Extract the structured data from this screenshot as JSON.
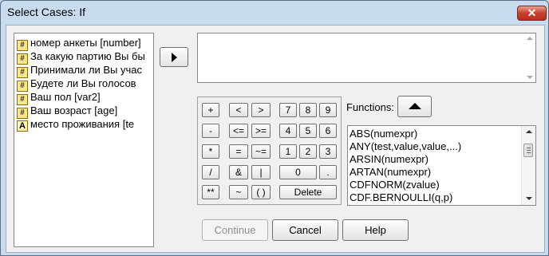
{
  "window": {
    "title": "Select Cases: If",
    "close_glyph": "✕"
  },
  "variables": [
    {
      "label": "номер анкеты [number]",
      "icon": "numeric-var-icon",
      "glyph": "#"
    },
    {
      "label": "За какую партию Вы бы",
      "icon": "numeric-var-icon",
      "glyph": "#"
    },
    {
      "label": "Принимали ли Вы учас",
      "icon": "numeric-var-icon",
      "glyph": "#"
    },
    {
      "label": "Будете ли Вы голосов",
      "icon": "numeric-var-icon",
      "glyph": "#"
    },
    {
      "label": "Ваш пол [var2]",
      "icon": "numeric-var-icon",
      "glyph": "#"
    },
    {
      "label": "Ваш возраст [age]",
      "icon": "numeric-var-icon",
      "glyph": "#"
    },
    {
      "label": "место проживания [te",
      "icon": "string-var-icon",
      "glyph": "A"
    }
  ],
  "expression": {
    "value": ""
  },
  "keypad": {
    "row1": [
      "+",
      "<",
      ">",
      "7",
      "8",
      "9"
    ],
    "row2": [
      "-",
      "<=",
      ">=",
      "4",
      "5",
      "6"
    ],
    "row3": [
      "*",
      "=",
      "~=",
      "1",
      "2",
      "3"
    ],
    "row4": [
      "/",
      "&",
      "|",
      "0",
      "."
    ],
    "row5": [
      "**",
      "~",
      "( )",
      "Delete"
    ]
  },
  "functions": {
    "label": "Functions:",
    "items": [
      "ABS(numexpr)",
      "ANY(test,value,value,...)",
      "ARSIN(numexpr)",
      "ARTAN(numexpr)",
      "CDFNORM(zvalue)",
      "CDF.BERNOULLI(q,p)"
    ]
  },
  "buttons": {
    "continue": "Continue",
    "cancel": "Cancel",
    "help": "Help"
  }
}
